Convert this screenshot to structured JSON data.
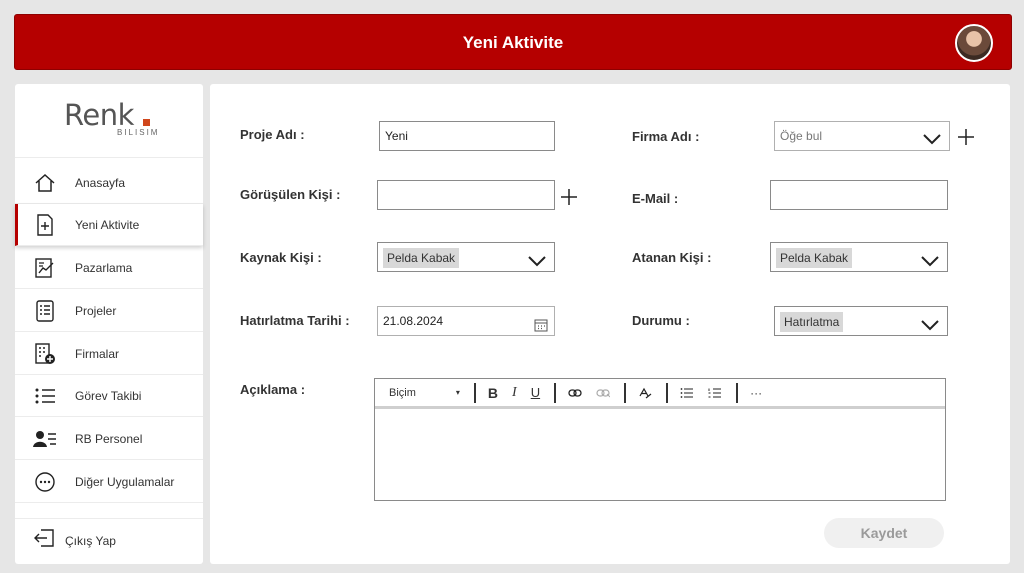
{
  "header": {
    "title": "Yeni Aktivite"
  },
  "logo": {
    "word": "Renk",
    "sub": "BILISIM"
  },
  "sidebar": {
    "items": [
      {
        "label": "Anasayfa",
        "icon": "home-icon"
      },
      {
        "label": "Yeni Aktivite",
        "icon": "new-document-icon",
        "active": true
      },
      {
        "label": "Pazarlama",
        "icon": "marketing-icon"
      },
      {
        "label": "Projeler",
        "icon": "projects-icon"
      },
      {
        "label": "Firmalar",
        "icon": "companies-icon"
      },
      {
        "label": "Görev Takibi",
        "icon": "task-list-icon"
      },
      {
        "label": "RB Personel",
        "icon": "personnel-icon"
      },
      {
        "label": "Diğer Uygulamalar",
        "icon": "more-apps-icon"
      }
    ],
    "logout": "Çıkış Yap"
  },
  "form": {
    "proje_adi": {
      "label": "Proje Adı :",
      "value": "Yeni"
    },
    "firma_adi": {
      "label": "Firma Adı :",
      "placeholder": "Öğe bul"
    },
    "gorusulen_kisi": {
      "label": "Görüşülen Kişi :",
      "value": ""
    },
    "email": {
      "label": "E-Mail :",
      "value": ""
    },
    "kaynak_kisi": {
      "label": "Kaynak Kişi :",
      "value": "Pelda Kabak"
    },
    "atanan_kisi": {
      "label": "Atanan Kişi :",
      "value": "Pelda Kabak"
    },
    "hatirlatma_tarihi": {
      "label": "Hatırlatma Tarihi :",
      "value": "21.08.2024"
    },
    "durumu": {
      "label": "Durumu :",
      "value": "Hatırlatma"
    },
    "aciklama": {
      "label": "Açıklama :",
      "format_label": "Biçim"
    }
  },
  "actions": {
    "save": "Kaydet"
  },
  "colors": {
    "brand": "#b50000",
    "logo_accent": "#d0471c"
  }
}
